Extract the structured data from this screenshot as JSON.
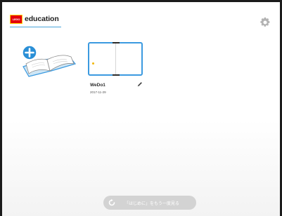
{
  "header": {
    "logo_text": "LEGO",
    "brand": "education"
  },
  "icons": {
    "settings": "gear-icon",
    "new_project": "add-project-icon",
    "edit": "pencil-icon",
    "replay": "replay-icon"
  },
  "projects": [
    {
      "name": "WeDo1",
      "date": "2017-11-29"
    }
  ],
  "footer": {
    "replay_label": "「はじめに」をもう一度見る"
  },
  "colors": {
    "accent": "#3b9ae0",
    "add_badge": "#2a8fd6",
    "logo_red": "#e3000b",
    "logo_yellow": "#ffd400",
    "project_dot": "#f2b600",
    "pill": "#d3d3d3"
  }
}
